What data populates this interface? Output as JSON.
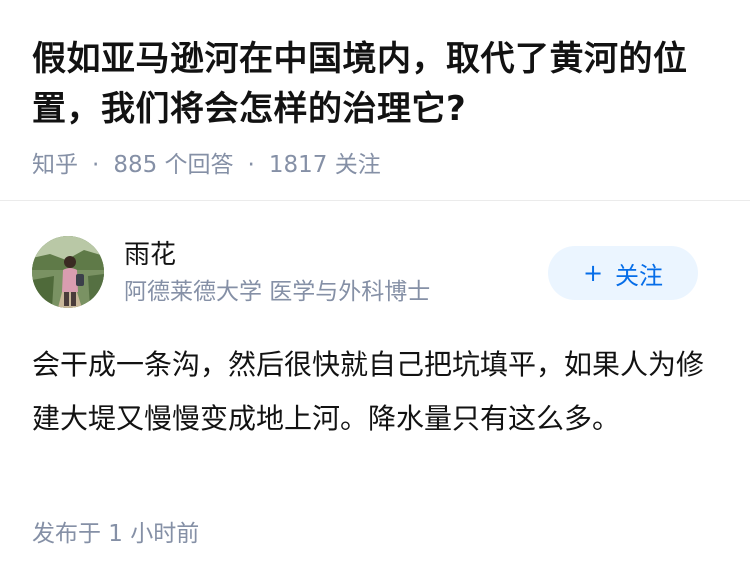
{
  "question": {
    "title": "假如亚马逊河在中国境内，取代了黄河的位置，我们将会怎样的治理它?",
    "source": "知乎",
    "answers_count": "885 个回答",
    "followers_count": "1817 关注"
  },
  "author": {
    "name": "雨花",
    "bio": "阿德莱德大学 医学与外科博士",
    "avatar": "avatar-photo",
    "follow_label": "关注",
    "follow_icon": "plus-icon",
    "follow_color": "#056de8",
    "follow_bg": "#ebf5ff"
  },
  "answer": {
    "content": "会干成一条沟，然后很快就自己把坑填平，如果人为修建大堤又慢慢变成地上河。降水量只有这么多。",
    "published_time": "发布于 1 小时前"
  },
  "colors": {
    "text_primary": "#121212",
    "text_secondary": "#8590a6",
    "divider": "#ebebeb"
  }
}
